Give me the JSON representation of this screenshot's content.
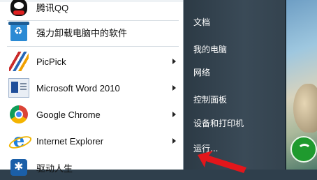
{
  "start_menu": {
    "programs": [
      {
        "label": "腾讯QQ",
        "icon": "qq-icon",
        "has_submenu": false
      },
      {
        "label": "强力卸载电脑中的软件",
        "icon": "uninstall-icon",
        "has_submenu": false
      },
      {
        "label": "PicPick",
        "icon": "picpick-icon",
        "has_submenu": true
      },
      {
        "label": "Microsoft Word 2010",
        "icon": "word-icon",
        "has_submenu": true
      },
      {
        "label": "Google Chrome",
        "icon": "chrome-icon",
        "has_submenu": true
      },
      {
        "label": "Internet Explorer",
        "icon": "ie-icon",
        "has_submenu": true
      },
      {
        "label": "驱动人生",
        "icon": "driver-icon",
        "has_submenu": false
      }
    ],
    "right_items": [
      {
        "label": "文档"
      },
      {
        "label": "我的电脑"
      },
      {
        "label": "网络"
      },
      {
        "label": "控制面板"
      },
      {
        "label": "设备和打印机"
      },
      {
        "label": "运行..."
      }
    ]
  },
  "colors": {
    "right_panel_bg": "#34434f",
    "annotation_arrow": "#e3161b"
  }
}
